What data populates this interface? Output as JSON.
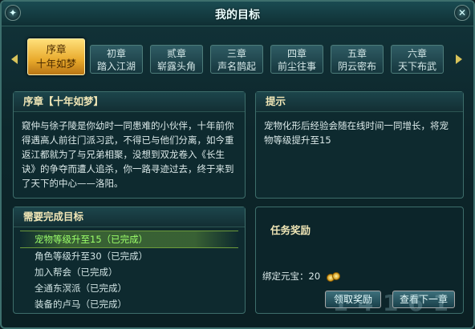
{
  "window": {
    "title": "我的目标",
    "left_button_icon": "info-icon",
    "close_icon": "close-icon"
  },
  "chapters": [
    {
      "line1": "序章",
      "line2": "十年如梦",
      "active": true
    },
    {
      "line1": "初章",
      "line2": "踏入江湖"
    },
    {
      "line1": "贰章",
      "line2": "崭露头角"
    },
    {
      "line1": "三章",
      "line2": "声名鹊起"
    },
    {
      "line1": "四章",
      "line2": "前尘往事"
    },
    {
      "line1": "五章",
      "line2": "阴云密布"
    },
    {
      "line1": "六章",
      "line2": "天下布武"
    }
  ],
  "story": {
    "title": "序章【十年如梦】",
    "text": "窥仲与徐子陵是你幼时一同患难的小伙伴，十年前你得遇高人前往门派习武，不得已与他们分离，如今重返江都就为了与兄弟相聚，没想到双龙卷入《长生诀》的争夺而遭人追杀，你一路寻迹过去，终于来到了天下的中心——洛阳。"
  },
  "tips": {
    "title": "提示",
    "text": "宠物化形后经验会随在线时间一同增长，将宠物等级提升至15"
  },
  "goals": {
    "title": "需要完成目标",
    "items": [
      {
        "text": "宠物等级升至15（已完成）",
        "active": true
      },
      {
        "text": "角色等级升至30（已完成）"
      },
      {
        "text": "加入帮会（已完成）"
      },
      {
        "text": "全通东溟派（已完成）"
      },
      {
        "text": "装备的卢马（已完成）"
      }
    ]
  },
  "rewards": {
    "title": "任务奖励",
    "label": "绑定元宝：20",
    "icon": "gold-ingot-icon"
  },
  "buttons": {
    "claim": "领取奖励",
    "next": "查看下一章"
  },
  "watermark": "1 4 1 6 1"
}
